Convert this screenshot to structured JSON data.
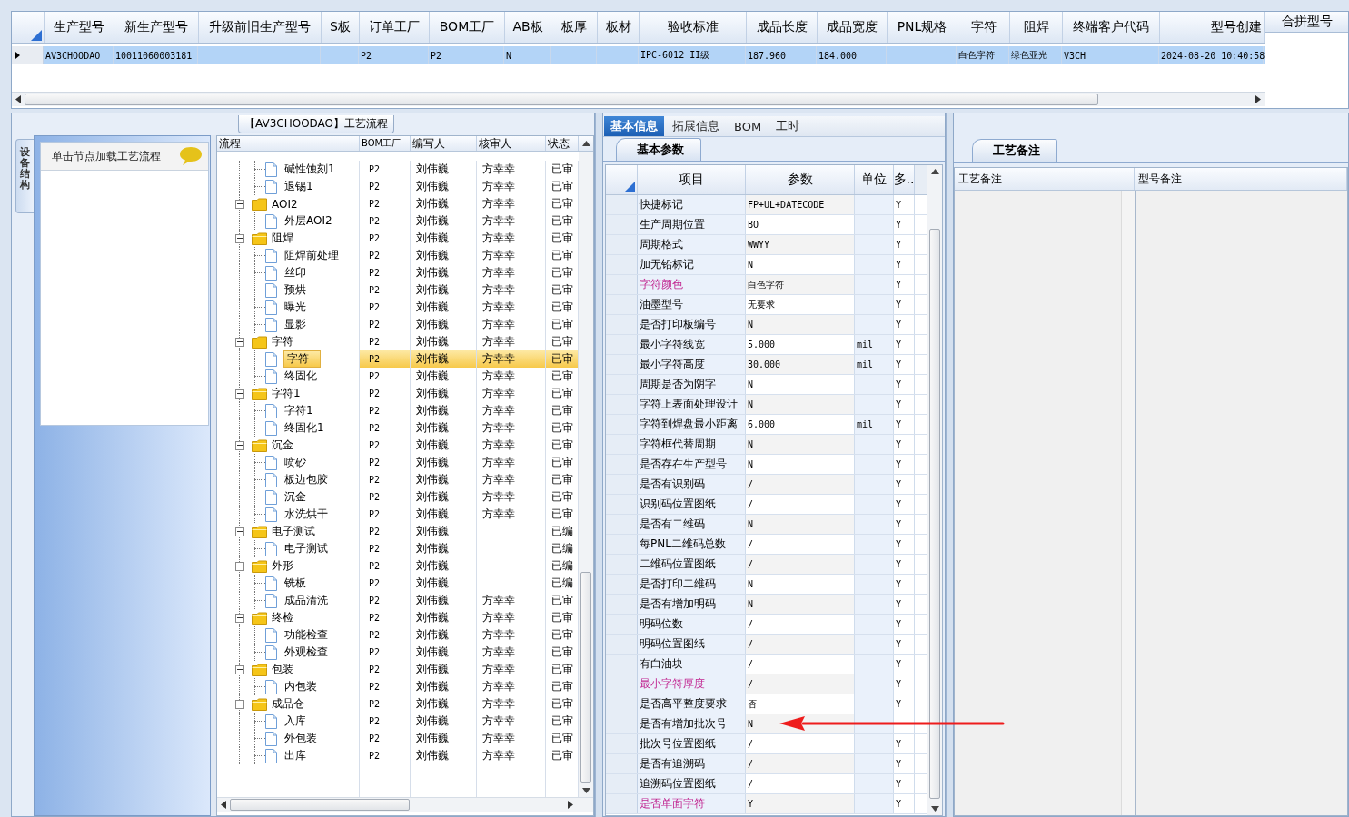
{
  "main_grid": {
    "columns": [
      "生产型号",
      "新生产型号",
      "升级前旧生产型号",
      "S板",
      "订单工厂",
      "BOM工厂",
      "AB板",
      "板厚",
      "板材",
      "验收标准",
      "成品长度",
      "成品宽度",
      "PNL规格",
      "字符",
      "阻焊",
      "终端客户代码",
      "型号创建"
    ],
    "rows": [
      {
        "selected": true,
        "cells": [
          "AV3CHOODAO",
          "10011060003181",
          null,
          null,
          "P2",
          "P2",
          "N",
          null,
          null,
          "IPC-6012 II级",
          "187.960",
          "184.000",
          null,
          "白色字符",
          "绿色亚光",
          "V3CH",
          "2024-08-20 10:40:58"
        ]
      }
    ]
  },
  "merge_panel": {
    "title": "合拼型号"
  },
  "process_panel": {
    "title": "【AV3CHOODAO】工艺流程"
  },
  "side_tab": {
    "label": "设备结构"
  },
  "node_panel": {
    "hint": "单击节点加载工艺流程"
  },
  "process_grid": {
    "columns": [
      "流程",
      "BOM工厂",
      "编写人",
      "核审人",
      "状态"
    ],
    "tree": [
      {
        "children": [
          {
            "kind": "step",
            "label": "碱性蚀刻1",
            "bom": "P2",
            "writer": "刘伟巍",
            "reviewer": "方幸幸",
            "status": "已审",
            "selected": false
          },
          {
            "kind": "step",
            "label": "退锡1",
            "bom": "P2",
            "writer": "刘伟巍",
            "reviewer": "方幸幸",
            "status": "已审",
            "selected": false
          }
        ]
      },
      {
        "kind": "folder",
        "expanded": true,
        "label": "AOI2",
        "bom": "P2",
        "writer": "刘伟巍",
        "reviewer": "方幸幸",
        "status": "已审",
        "selected": false,
        "children": [
          {
            "kind": "step",
            "label": "外层AOI2",
            "bom": "P2",
            "writer": "刘伟巍",
            "reviewer": "方幸幸",
            "status": "已审",
            "selected": false
          }
        ]
      },
      {
        "kind": "folder",
        "expanded": true,
        "label": "阻焊",
        "bom": "P2",
        "writer": "刘伟巍",
        "reviewer": "方幸幸",
        "status": "已审",
        "selected": false,
        "children": [
          {
            "kind": "step",
            "label": "阻焊前处理",
            "bom": "P2",
            "writer": "刘伟巍",
            "reviewer": "方幸幸",
            "status": "已审",
            "selected": false
          },
          {
            "kind": "step",
            "label": "丝印",
            "bom": "P2",
            "writer": "刘伟巍",
            "reviewer": "方幸幸",
            "status": "已审",
            "selected": false
          },
          {
            "kind": "step",
            "label": "预烘",
            "bom": "P2",
            "writer": "刘伟巍",
            "reviewer": "方幸幸",
            "status": "已审",
            "selected": false
          },
          {
            "kind": "step",
            "label": "曝光",
            "bom": "P2",
            "writer": "刘伟巍",
            "reviewer": "方幸幸",
            "status": "已审",
            "selected": false
          },
          {
            "kind": "step",
            "label": "显影",
            "bom": "P2",
            "writer": "刘伟巍",
            "reviewer": "方幸幸",
            "status": "已审",
            "selected": false
          }
        ]
      },
      {
        "kind": "folder",
        "expanded": true,
        "label": "字符",
        "bom": "P2",
        "writer": "刘伟巍",
        "reviewer": "方幸幸",
        "status": "已审",
        "selected": false,
        "children": [
          {
            "kind": "step",
            "label": "字符",
            "bom": "P2",
            "writer": "刘伟巍",
            "reviewer": "方幸幸",
            "status": "已审",
            "selected": true
          },
          {
            "kind": "step",
            "label": "终固化",
            "bom": "P2",
            "writer": "刘伟巍",
            "reviewer": "方幸幸",
            "status": "已审",
            "selected": false
          }
        ]
      },
      {
        "kind": "folder",
        "expanded": true,
        "label": "字符1",
        "bom": "P2",
        "writer": "刘伟巍",
        "reviewer": "方幸幸",
        "status": "已审",
        "selected": false,
        "children": [
          {
            "kind": "step",
            "label": "字符1",
            "bom": "P2",
            "writer": "刘伟巍",
            "reviewer": "方幸幸",
            "status": "已审",
            "selected": false
          },
          {
            "kind": "step",
            "label": "终固化1",
            "bom": "P2",
            "writer": "刘伟巍",
            "reviewer": "方幸幸",
            "status": "已审",
            "selected": false
          }
        ]
      },
      {
        "kind": "folder",
        "expanded": true,
        "label": "沉金",
        "bom": "P2",
        "writer": "刘伟巍",
        "reviewer": "方幸幸",
        "status": "已审",
        "selected": false,
        "children": [
          {
            "kind": "step",
            "label": "喷砂",
            "bom": "P2",
            "writer": "刘伟巍",
            "reviewer": "方幸幸",
            "status": "已审",
            "selected": false
          },
          {
            "kind": "step",
            "label": "板边包胶",
            "bom": "P2",
            "writer": "刘伟巍",
            "reviewer": "方幸幸",
            "status": "已审",
            "selected": false
          },
          {
            "kind": "step",
            "label": "沉金",
            "bom": "P2",
            "writer": "刘伟巍",
            "reviewer": "方幸幸",
            "status": "已审",
            "selected": false
          },
          {
            "kind": "step",
            "label": "水洗烘干",
            "bom": "P2",
            "writer": "刘伟巍",
            "reviewer": "方幸幸",
            "status": "已审",
            "selected": false
          }
        ]
      },
      {
        "kind": "folder",
        "expanded": true,
        "label": "电子测试",
        "bom": "P2",
        "writer": "刘伟巍",
        "status": "已编",
        "selected": false,
        "children": [
          {
            "kind": "step",
            "label": "电子测试",
            "bom": "P2",
            "writer": "刘伟巍",
            "status": "已编",
            "selected": false
          }
        ]
      },
      {
        "kind": "folder",
        "expanded": true,
        "label": "外形",
        "bom": "P2",
        "writer": "刘伟巍",
        "status": "已编",
        "selected": false,
        "children": [
          {
            "kind": "step",
            "label": "铣板",
            "bom": "P2",
            "writer": "刘伟巍",
            "status": "已编",
            "selected": false
          },
          {
            "kind": "step",
            "label": "成品清洗",
            "bom": "P2",
            "writer": "刘伟巍",
            "reviewer": "方幸幸",
            "status": "已审",
            "selected": false
          }
        ]
      },
      {
        "kind": "folder",
        "expanded": true,
        "label": "终检",
        "bom": "P2",
        "writer": "刘伟巍",
        "reviewer": "方幸幸",
        "status": "已审",
        "selected": false,
        "children": [
          {
            "kind": "step",
            "label": "功能检查",
            "bom": "P2",
            "writer": "刘伟巍",
            "reviewer": "方幸幸",
            "status": "已审",
            "selected": false
          },
          {
            "kind": "step",
            "label": "外观检查",
            "bom": "P2",
            "writer": "刘伟巍",
            "reviewer": "方幸幸",
            "status": "已审",
            "selected": false
          }
        ]
      },
      {
        "kind": "folder",
        "expanded": true,
        "label": "包装",
        "bom": "P2",
        "writer": "刘伟巍",
        "reviewer": "方幸幸",
        "status": "已审",
        "selected": false,
        "children": [
          {
            "kind": "step",
            "label": "内包装",
            "bom": "P2",
            "writer": "刘伟巍",
            "reviewer": "方幸幸",
            "status": "已审",
            "selected": false
          }
        ]
      },
      {
        "kind": "folder",
        "expanded": true,
        "label": "成品仓",
        "bom": "P2",
        "writer": "刘伟巍",
        "reviewer": "方幸幸",
        "status": "已审",
        "selected": false,
        "children": [
          {
            "kind": "step",
            "label": "入库",
            "bom": "P2",
            "writer": "刘伟巍",
            "reviewer": "方幸幸",
            "status": "已审",
            "selected": false
          },
          {
            "kind": "step",
            "label": "外包装",
            "bom": "P2",
            "writer": "刘伟巍",
            "reviewer": "方幸幸",
            "status": "已审",
            "selected": false
          },
          {
            "kind": "step",
            "label": "出库",
            "bom": "P2",
            "writer": "刘伟巍",
            "reviewer": "方幸幸",
            "status": "已审",
            "selected": false
          }
        ]
      }
    ]
  },
  "detail_tabs": [
    {
      "label": "基本信息",
      "selected": true
    },
    {
      "label": "拓展信息",
      "selected": false
    },
    {
      "label": "BOM",
      "selected": false
    },
    {
      "label": "工时",
      "selected": false
    }
  ],
  "param_tab": {
    "label": "基本参数"
  },
  "param_grid": {
    "columns": [
      "项目",
      "参数",
      "单位",
      "多.."
    ],
    "rows": [
      {
        "item": "快捷标记",
        "value": "FP+UL+DATECODE",
        "flag": "Y",
        "emphasized": false
      },
      {
        "item": "生产周期位置",
        "value": "BO",
        "flag": "Y",
        "emphasized": false
      },
      {
        "item": "周期格式",
        "value": "WWYY",
        "flag": "Y",
        "emphasized": false
      },
      {
        "item": "加无铅标记",
        "value": "N",
        "flag": "Y",
        "emphasized": false
      },
      {
        "item": "字符颜色",
        "value": "白色字符",
        "flag": "Y",
        "emphasized": true
      },
      {
        "item": "油墨型号",
        "value": "无要求",
        "flag": "Y",
        "emphasized": false
      },
      {
        "item": "是否打印板编号",
        "value": "N",
        "flag": "Y",
        "emphasized": false
      },
      {
        "item": "最小字符线宽",
        "value": "5.000",
        "unit": "mil",
        "flag": "Y",
        "emphasized": false
      },
      {
        "item": "最小字符高度",
        "value": "30.000",
        "unit": "mil",
        "flag": "Y",
        "emphasized": false
      },
      {
        "item": "周期是否为阴字",
        "value": "N",
        "flag": "Y",
        "emphasized": false
      },
      {
        "item": "字符上表面处理设计",
        "value": "N",
        "flag": "Y",
        "emphasized": false
      },
      {
        "item": "字符到焊盘最小距离",
        "value": "6.000",
        "unit": "mil",
        "flag": "Y",
        "emphasized": false
      },
      {
        "item": "字符框代替周期",
        "value": "N",
        "flag": "Y",
        "emphasized": false
      },
      {
        "item": "是否存在生产型号",
        "value": "N",
        "flag": "Y",
        "emphasized": false
      },
      {
        "item": "是否有识别码",
        "value": "/",
        "flag": "Y",
        "emphasized": false
      },
      {
        "item": "识别码位置图纸",
        "value": "/",
        "flag": "Y",
        "emphasized": false
      },
      {
        "item": "是否有二维码",
        "value": "N",
        "flag": "Y",
        "emphasized": false
      },
      {
        "item": "每PNL二维码总数",
        "value": "/",
        "flag": "Y",
        "emphasized": false
      },
      {
        "item": "二维码位置图纸",
        "value": "/",
        "flag": "Y",
        "emphasized": false
      },
      {
        "item": "是否打印二维码",
        "value": "N",
        "flag": "Y",
        "emphasized": false
      },
      {
        "item": "是否有增加明码",
        "value": "N",
        "flag": "Y",
        "emphasized": false
      },
      {
        "item": "明码位数",
        "value": "/",
        "flag": "Y",
        "emphasized": false
      },
      {
        "item": "明码位置图纸",
        "value": "/",
        "flag": "Y",
        "emphasized": false
      },
      {
        "item": "有白油块",
        "value": "/",
        "flag": "Y",
        "emphasized": false
      },
      {
        "item": "最小字符厚度",
        "value": "/",
        "flag": "Y",
        "emphasized": true
      },
      {
        "item": "是否高平整度要求",
        "value": "否",
        "flag": "Y",
        "emphasized": false
      },
      {
        "item": "是否有增加批次号",
        "value": "N",
        "emphasized": false
      },
      {
        "item": "批次号位置图纸",
        "value": "/",
        "flag": "Y",
        "emphasized": false
      },
      {
        "item": "是否有追溯码",
        "value": "/",
        "flag": "Y",
        "emphasized": false
      },
      {
        "item": "追溯码位置图纸",
        "value": "/",
        "flag": "Y",
        "emphasized": false
      },
      {
        "item": "是否单面字符",
        "value": "Y",
        "flag": "Y",
        "emphasized": true
      }
    ]
  },
  "notes_tab": {
    "label": "工艺备注"
  },
  "notes_grid": {
    "columns": [
      "工艺备注",
      "型号备注"
    ]
  }
}
